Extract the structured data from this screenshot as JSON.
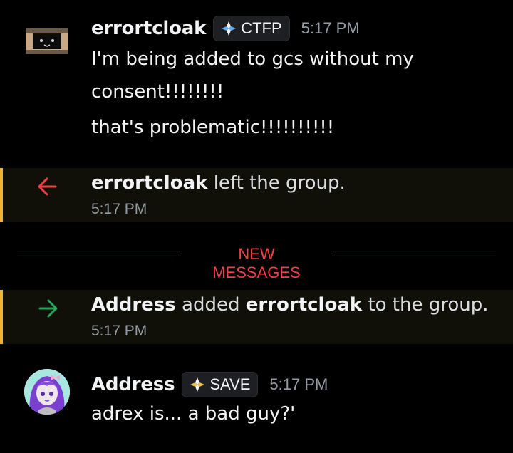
{
  "messages": [
    {
      "username": "errortcloak",
      "tag": "CTFP",
      "time": "5:17 PM",
      "lines": [
        "I'm being added to gcs without my",
        "consent!!!!!!!!",
        "that's problematic!!!!!!!!!!"
      ]
    },
    {
      "username": "Address",
      "tag": "SAVE",
      "time": "5:17 PM",
      "lines": [
        "adrex is... a bad guy?'"
      ]
    }
  ],
  "system": [
    {
      "type": "leave",
      "actor": "errortcloak",
      "text": "left the group.",
      "time": "5:17 PM",
      "arrow_color": "#f23f43"
    },
    {
      "type": "join",
      "actor": "Address",
      "middle": "added",
      "target": "errortcloak",
      "text": "to the group.",
      "time": "5:17 PM",
      "arrow_color": "#23a55a"
    }
  ],
  "divider": {
    "label": "NEW MESSAGES",
    "color": "#f23f43"
  },
  "colors": {
    "background": "#000000",
    "system_accent": "#f0b232",
    "timestamp": "#949ba4"
  }
}
